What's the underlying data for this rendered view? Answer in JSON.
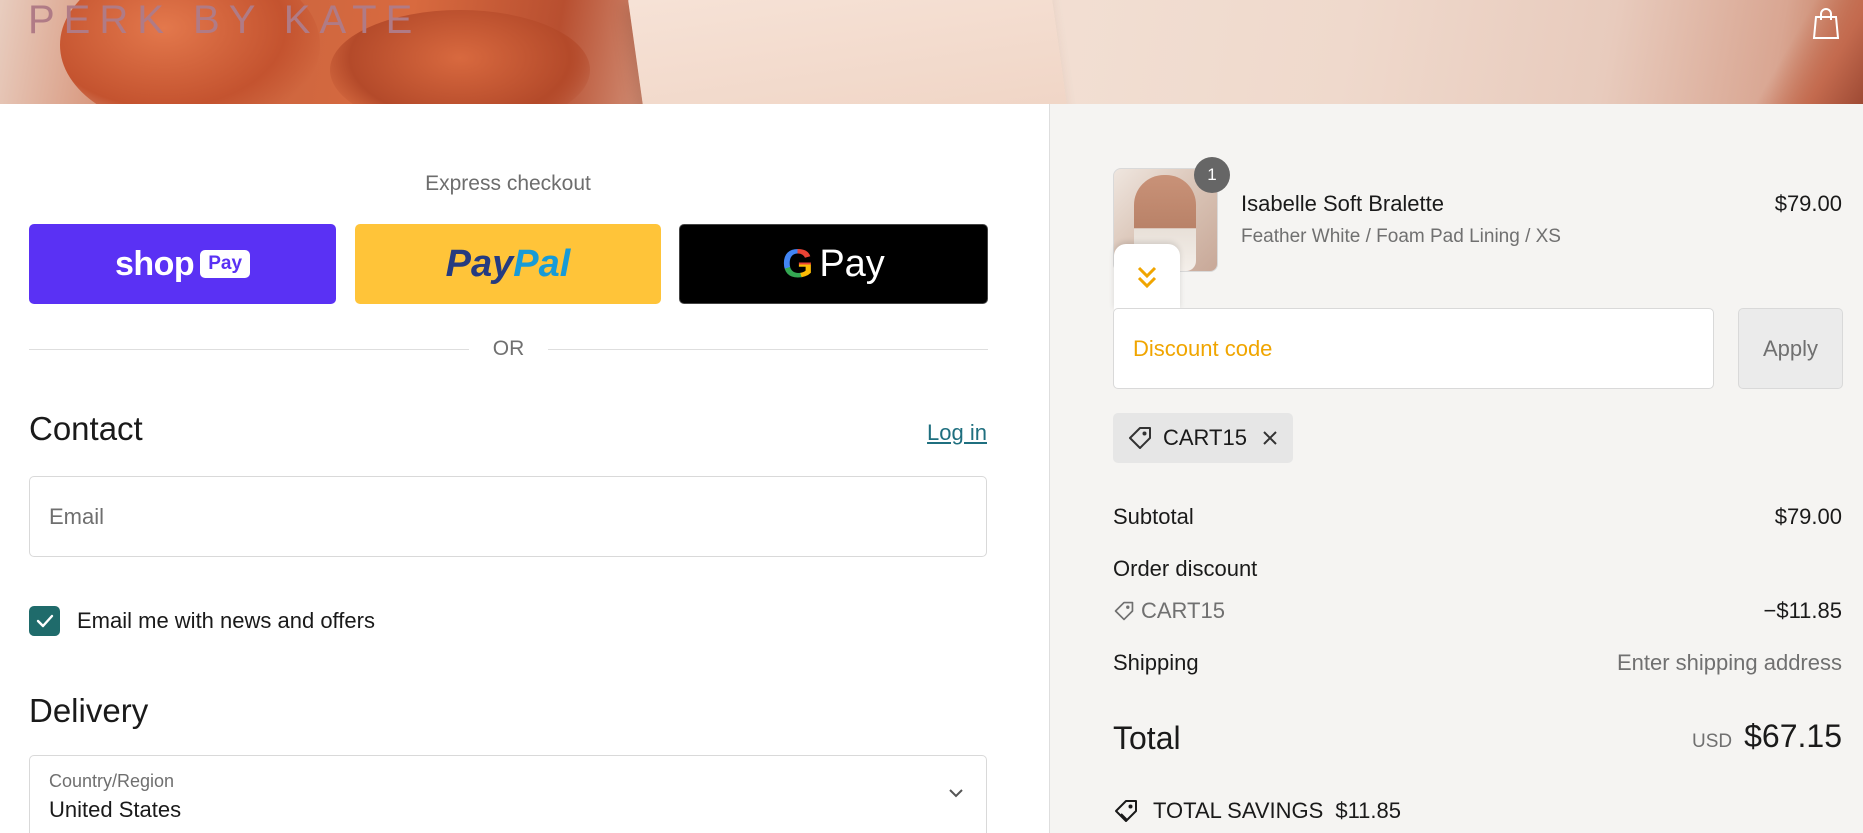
{
  "header": {
    "brand": "PERK BY KATE",
    "cart_icon": "shopping-bag-icon"
  },
  "express": {
    "title": "Express checkout",
    "shop_pay": {
      "text": "shop",
      "pill": "Pay"
    },
    "paypal": {
      "part1": "Pay",
      "part2": "Pal"
    },
    "gpay": {
      "g": "G",
      "text": "Pay"
    },
    "or": "OR"
  },
  "contact": {
    "title": "Contact",
    "login": "Log in",
    "email_placeholder": "Email",
    "newsletter_label": "Email me with news and offers",
    "newsletter_checked": true
  },
  "delivery": {
    "title": "Delivery",
    "country_label": "Country/Region",
    "country_value": "United States"
  },
  "order": {
    "item": {
      "quantity": "1",
      "name": "Isabelle Soft Bralette",
      "variant": "Feather White / Foam Pad Lining / XS",
      "price": "$79.00"
    },
    "discount_placeholder": "Discount code",
    "apply": "Apply",
    "applied_code": "CART15",
    "subtotal_label": "Subtotal",
    "subtotal_value": "$79.00",
    "order_discount_label": "Order discount",
    "discount_code": "CART15",
    "discount_value": "−$11.85",
    "shipping_label": "Shipping",
    "shipping_value": "Enter shipping address",
    "total_label": "Total",
    "currency": "USD",
    "total_value": "$67.15",
    "savings_label": "TOTAL SAVINGS",
    "savings_value": "$11.85"
  },
  "colors": {
    "shop_pay": "#5a31f4",
    "paypal": "#ffc439",
    "gpay": "#000000",
    "checkbox": "#1f6b6b",
    "discount_placeholder": "#f0a500"
  }
}
